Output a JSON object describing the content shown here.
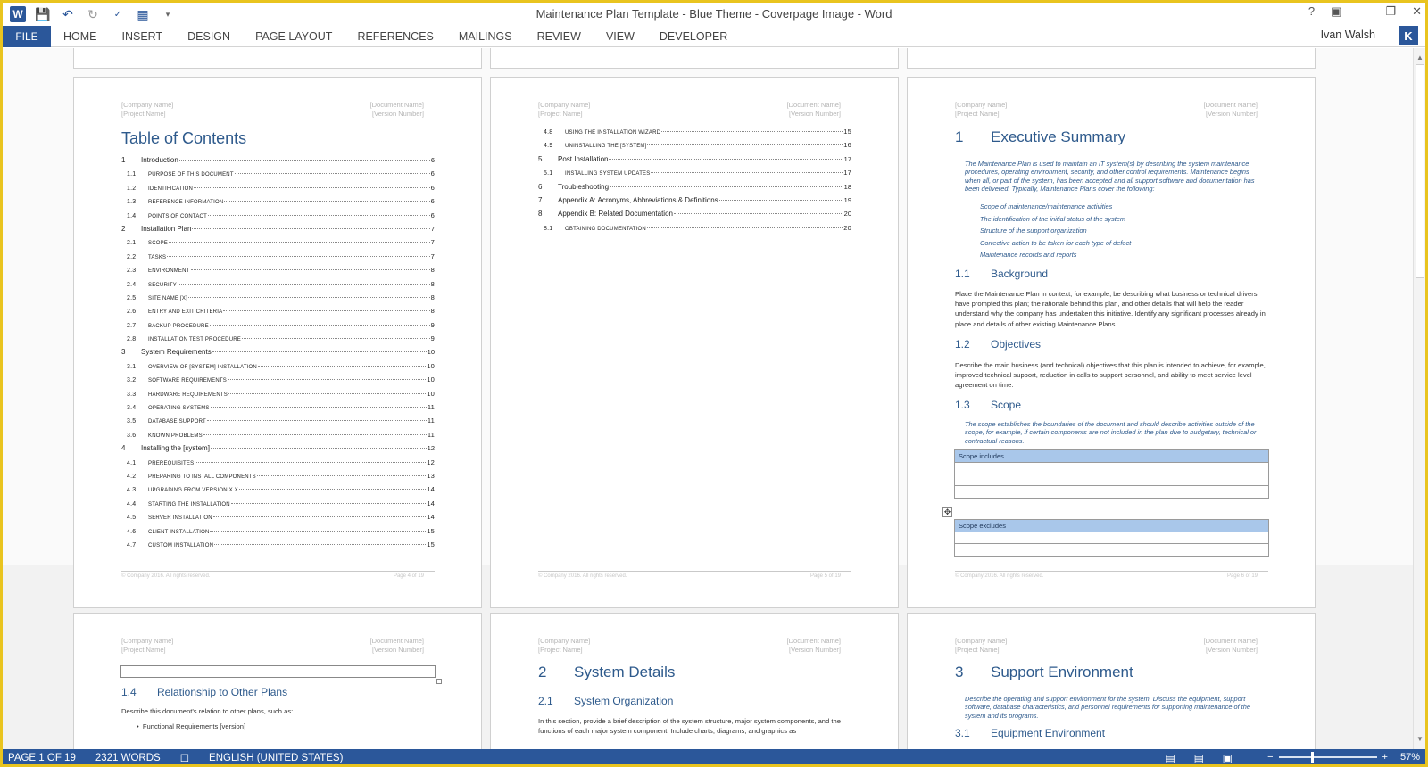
{
  "window": {
    "title": "Maintenance Plan Template - Blue Theme - Coverpage Image - Word",
    "user": "Ivan Walsh",
    "avatar_letter": "K",
    "help": "?"
  },
  "ribbon": {
    "tabs": [
      "FILE",
      "HOME",
      "INSERT",
      "DESIGN",
      "PAGE LAYOUT",
      "REFERENCES",
      "MAILINGS",
      "REVIEW",
      "VIEW",
      "DEVELOPER"
    ]
  },
  "header_placeholders": {
    "company": "[Company Name]",
    "project": "[Project Name]",
    "document": "[Document Name]",
    "version": "[Version Number]"
  },
  "footer": {
    "copyright": "© Company 2016. All rights reserved.",
    "page4": "Page 4 of 19",
    "page5": "Page 5 of 19",
    "page6": "Page 6 of 19"
  },
  "toc": {
    "title": "Table of Contents",
    "entries": [
      {
        "num": "1",
        "text": "Introduction",
        "page": "6",
        "level": 1
      },
      {
        "num": "1.1",
        "text": "Purpose of this document",
        "page": "6",
        "level": 2
      },
      {
        "num": "1.2",
        "text": "Identification",
        "page": "6",
        "level": 2
      },
      {
        "num": "1.3",
        "text": "Reference information",
        "page": "6",
        "level": 2
      },
      {
        "num": "1.4",
        "text": "Points of Contact",
        "page": "6",
        "level": 2
      },
      {
        "num": "2",
        "text": "Installation Plan",
        "page": "7",
        "level": 1
      },
      {
        "num": "2.1",
        "text": "Scope",
        "page": "7",
        "level": 2
      },
      {
        "num": "2.2",
        "text": "Tasks",
        "page": "7",
        "level": 2
      },
      {
        "num": "2.3",
        "text": "Environment",
        "page": "8",
        "level": 2
      },
      {
        "num": "2.4",
        "text": "Security",
        "page": "8",
        "level": 2
      },
      {
        "num": "2.5",
        "text": "Site Name [x]",
        "page": "8",
        "level": 2
      },
      {
        "num": "2.6",
        "text": "Entry and Exit Criteria",
        "page": "8",
        "level": 2
      },
      {
        "num": "2.7",
        "text": "Backup Procedure",
        "page": "9",
        "level": 2
      },
      {
        "num": "2.8",
        "text": "Installation Test Procedure",
        "page": "9",
        "level": 2
      },
      {
        "num": "3",
        "text": "System Requirements",
        "page": "10",
        "level": 1
      },
      {
        "num": "3.1",
        "text": "Overview of [system] installation",
        "page": "10",
        "level": 2
      },
      {
        "num": "3.2",
        "text": "Software Requirements",
        "page": "10",
        "level": 2
      },
      {
        "num": "3.3",
        "text": "Hardware Requirements",
        "page": "10",
        "level": 2
      },
      {
        "num": "3.4",
        "text": "Operating Systems",
        "page": "11",
        "level": 2
      },
      {
        "num": "3.5",
        "text": "Database Support",
        "page": "11",
        "level": 2
      },
      {
        "num": "3.6",
        "text": "Known problems",
        "page": "11",
        "level": 2
      },
      {
        "num": "4",
        "text": "Installing the [system]",
        "page": "12",
        "level": 1
      },
      {
        "num": "4.1",
        "text": "Prerequisites",
        "page": "12",
        "level": 2
      },
      {
        "num": "4.2",
        "text": "Preparing to install components",
        "page": "13",
        "level": 2
      },
      {
        "num": "4.3",
        "text": "Upgrading from Version X.x",
        "page": "14",
        "level": 2
      },
      {
        "num": "4.4",
        "text": "Starting the installation",
        "page": "14",
        "level": 2
      },
      {
        "num": "4.5",
        "text": "Server Installation",
        "page": "14",
        "level": 2
      },
      {
        "num": "4.6",
        "text": "Client Installation",
        "page": "15",
        "level": 2
      },
      {
        "num": "4.7",
        "text": "Custom Installation",
        "page": "15",
        "level": 2
      }
    ],
    "entries_cont": [
      {
        "num": "4.8",
        "text": "Using the Installation Wizard",
        "page": "15",
        "level": 2
      },
      {
        "num": "4.9",
        "text": "Uninstalling the [system]",
        "page": "16",
        "level": 2
      },
      {
        "num": "5",
        "text": "Post Installation",
        "page": "17",
        "level": 1
      },
      {
        "num": "5.1",
        "text": "Installing System Updates",
        "page": "17",
        "level": 2
      },
      {
        "num": "6",
        "text": "Troubleshooting",
        "page": "18",
        "level": 1
      },
      {
        "num": "7",
        "text": "Appendix A: Acronyms, Abbreviations & Definitions",
        "page": "19",
        "level": 1
      },
      {
        "num": "8",
        "text": "Appendix B: Related Documentation",
        "page": "20",
        "level": 1
      },
      {
        "num": "8.1",
        "text": "Obtaining Documentation",
        "page": "20",
        "level": 2
      }
    ]
  },
  "exec": {
    "h1_num": "1",
    "h1": "Executive Summary",
    "intro": "The Maintenance Plan is used to maintain an IT system(s) by describing the system maintenance procedures, operating environment, security, and other control requirements. Maintenance begins when all, or part of the system, has been accepted and all support software and documentation has been delivered. Typically, Maintenance Plans cover the following:",
    "bullets": [
      "Scope of maintenance/maintenance activities",
      "The identification of the initial status of the system",
      "Structure of the support organization",
      "Corrective action to be taken for each type of defect",
      "Maintenance records and reports"
    ],
    "bg_num": "1.1",
    "bg_h": "Background",
    "bg_text": "Place the Maintenance Plan in context, for example, be describing what business or technical drivers have prompted this plan; the rationale behind this plan, and other details that will help the reader understand why the company has undertaken this initiative. Identify any significant processes already in place and details of other existing Maintenance Plans.",
    "obj_num": "1.2",
    "obj_h": "Objectives",
    "obj_text": "Describe the main business (and technical) objectives that this plan is intended to achieve, for example, improved technical support, reduction in calls to support personnel, and ability to meet service level agreement on time.",
    "scope_num": "1.3",
    "scope_h": "Scope",
    "scope_text": "The scope establishes the boundaries of the document and should describe activities outside of the scope, for example, if certain components are not included in the plan due to budgetary, technical or contractual reasons.",
    "scope_includes": "Scope includes",
    "scope_excludes": "Scope excludes"
  },
  "rel": {
    "num": "1.4",
    "h": "Relationship to Other Plans",
    "text": "Describe this document's relation to other plans, such as:",
    "bullet": "Functional Requirements [version]"
  },
  "sys": {
    "h1_num": "2",
    "h1": "System Details",
    "h2_num": "2.1",
    "h2": "System Organization",
    "text": "In this section, provide a brief description of the system structure, major system components, and the functions of each major system component. Include charts, diagrams, and graphics as"
  },
  "support": {
    "h1_num": "3",
    "h1": "Support Environment",
    "text": "Describe the operating and support environment for the system. Discuss the equipment, support software, database characteristics, and personnel requirements for supporting maintenance of the system and its programs.",
    "h2_num": "3.1",
    "h2": "Equipment Environment"
  },
  "status": {
    "page": "PAGE 1 OF 19",
    "words": "2321 WORDS",
    "language": "ENGLISH (UNITED STATES)",
    "zoom": "57%"
  }
}
